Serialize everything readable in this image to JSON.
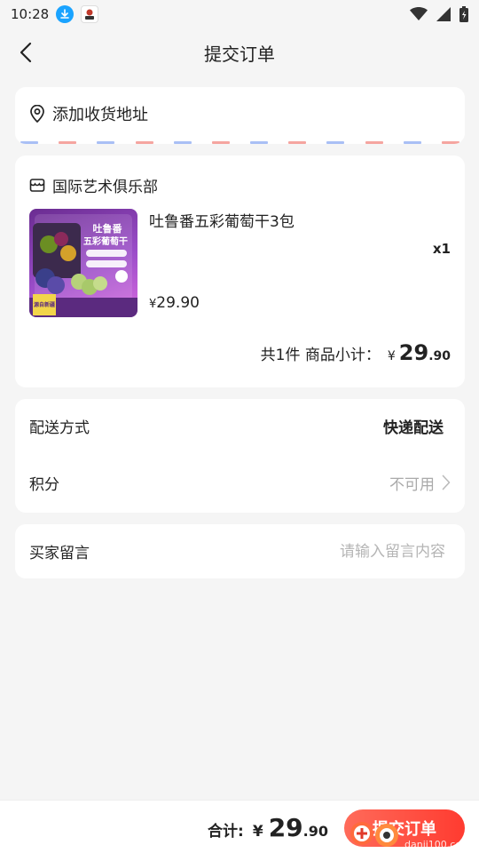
{
  "status_bar": {
    "time": "10:28"
  },
  "nav": {
    "title": "提交订单"
  },
  "address": {
    "label": "添加收货地址",
    "stripe_colors": [
      "#a9bff5",
      "#f5a5a0"
    ]
  },
  "shop": {
    "name": "国际艺术俱乐部",
    "product": {
      "name": "吐鲁番五彩葡萄干3包",
      "quantity": "x1",
      "price_symbol": "¥",
      "price": "29.90",
      "thumbnail_text": {
        "headline_1": "吐鲁番",
        "headline_2": "五彩葡萄干",
        "origin": "源自新疆"
      }
    },
    "subtotal": {
      "label": "共1件 商品小计：",
      "symbol": "¥",
      "integer": "29",
      "decimal": ".90"
    }
  },
  "delivery": {
    "method_label": "配送方式",
    "method_value": "快递配送",
    "points_label": "积分",
    "points_value": "不可用"
  },
  "message": {
    "label": "买家留言",
    "placeholder": "请输入留言内容"
  },
  "footer": {
    "total_label": "合计:",
    "symbol": "¥",
    "total_integer": "29",
    "total_decimal": ".90",
    "submit_label": "提交订单",
    "watermark_text": "danji100.com"
  },
  "colors": {
    "accent": "#ff4a3d",
    "background": "#f5f5f5",
    "muted_text": "#aaaaaa"
  }
}
